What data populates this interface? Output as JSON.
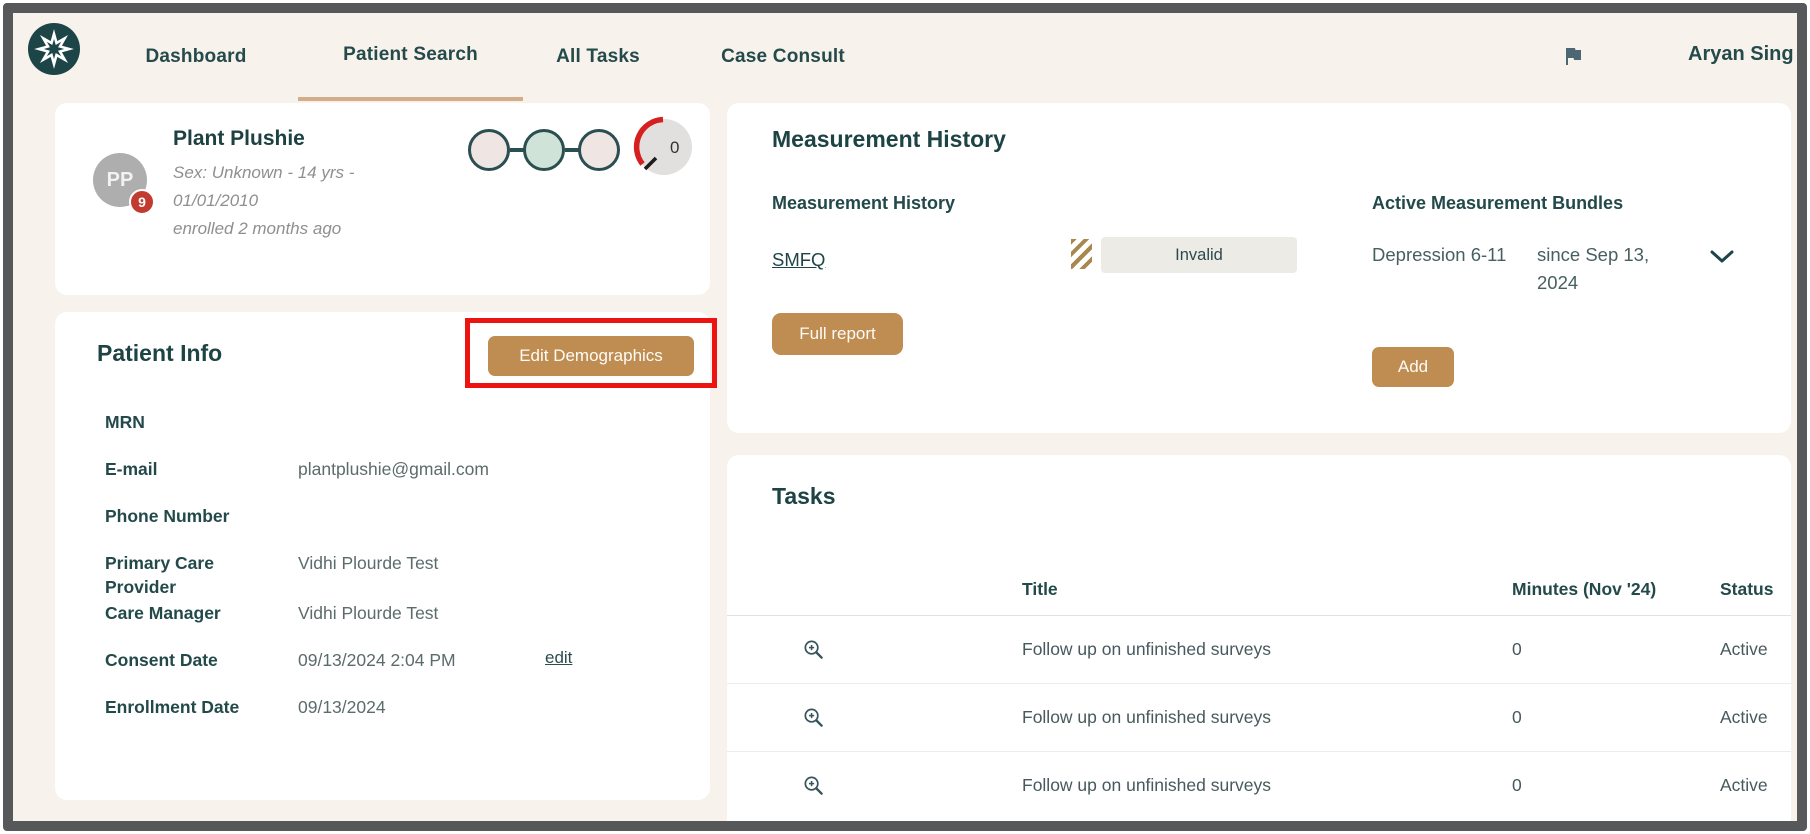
{
  "nav": {
    "items": [
      {
        "label": "Dashboard",
        "active": false
      },
      {
        "label": "Patient Search",
        "active": true
      },
      {
        "label": "All Tasks",
        "active": false
      },
      {
        "label": "Case Consult",
        "active": false
      }
    ],
    "user": "Aryan Sing"
  },
  "patient_card": {
    "initials": "PP",
    "badge_count": "9",
    "name": "Plant Plushie",
    "demographics_line1": "Sex: Unknown - 14 yrs -",
    "demographics_line2": "01/01/2010",
    "enrolled": "enrolled 2 months ago",
    "stepper_steps": [
      {
        "state": "empty"
      },
      {
        "state": "filled"
      },
      {
        "state": "empty"
      }
    ],
    "gauge_value": "0"
  },
  "patient_info": {
    "title": "Patient Info",
    "edit_button": "Edit Demographics",
    "fields": [
      {
        "label": "MRN",
        "value": ""
      },
      {
        "label": "E-mail",
        "value": "plantplushie@gmail.com"
      },
      {
        "label": "Phone Number",
        "value": ""
      },
      {
        "label": "Primary Care Provider",
        "value": "Vidhi Plourde Test"
      },
      {
        "label": "Care Manager",
        "value": "Vidhi Plourde Test"
      },
      {
        "label": "Consent Date",
        "value": "09/13/2024 2:04 PM",
        "action": "edit"
      },
      {
        "label": "Enrollment Date",
        "value": "09/13/2024"
      }
    ]
  },
  "measurement": {
    "title": "Measurement History",
    "history_subtitle": "Measurement History",
    "survey_link": "SMFQ",
    "status_badge": "Invalid",
    "full_report_button": "Full report",
    "bundles_subtitle": "Active Measurement Bundles",
    "bundle_name": "Depression 6-11",
    "bundle_since": "since Sep 13, 2024",
    "add_button": "Add"
  },
  "tasks": {
    "title": "Tasks",
    "columns": [
      "Title",
      "Minutes (Nov '24)",
      "Status"
    ],
    "rows": [
      {
        "title": "Follow up on unfinished surveys",
        "minutes": "0",
        "status": "Active"
      },
      {
        "title": "Follow up on unfinished surveys",
        "minutes": "0",
        "status": "Active"
      },
      {
        "title": "Follow up on unfinished surveys",
        "minutes": "0",
        "status": "Active"
      }
    ]
  },
  "colors": {
    "background": "#f7f2eb",
    "card": "#ffffff",
    "teal_text": "#1d4547",
    "accent_tan": "#bf8c51",
    "tab_underline": "#d3ad89",
    "annotation_red": "#ec1310",
    "badge_red": "#c23b30",
    "mint_step": "#cfe3d8",
    "invalid_badge_bg": "#edebe5",
    "frame_border": "#57585a"
  }
}
